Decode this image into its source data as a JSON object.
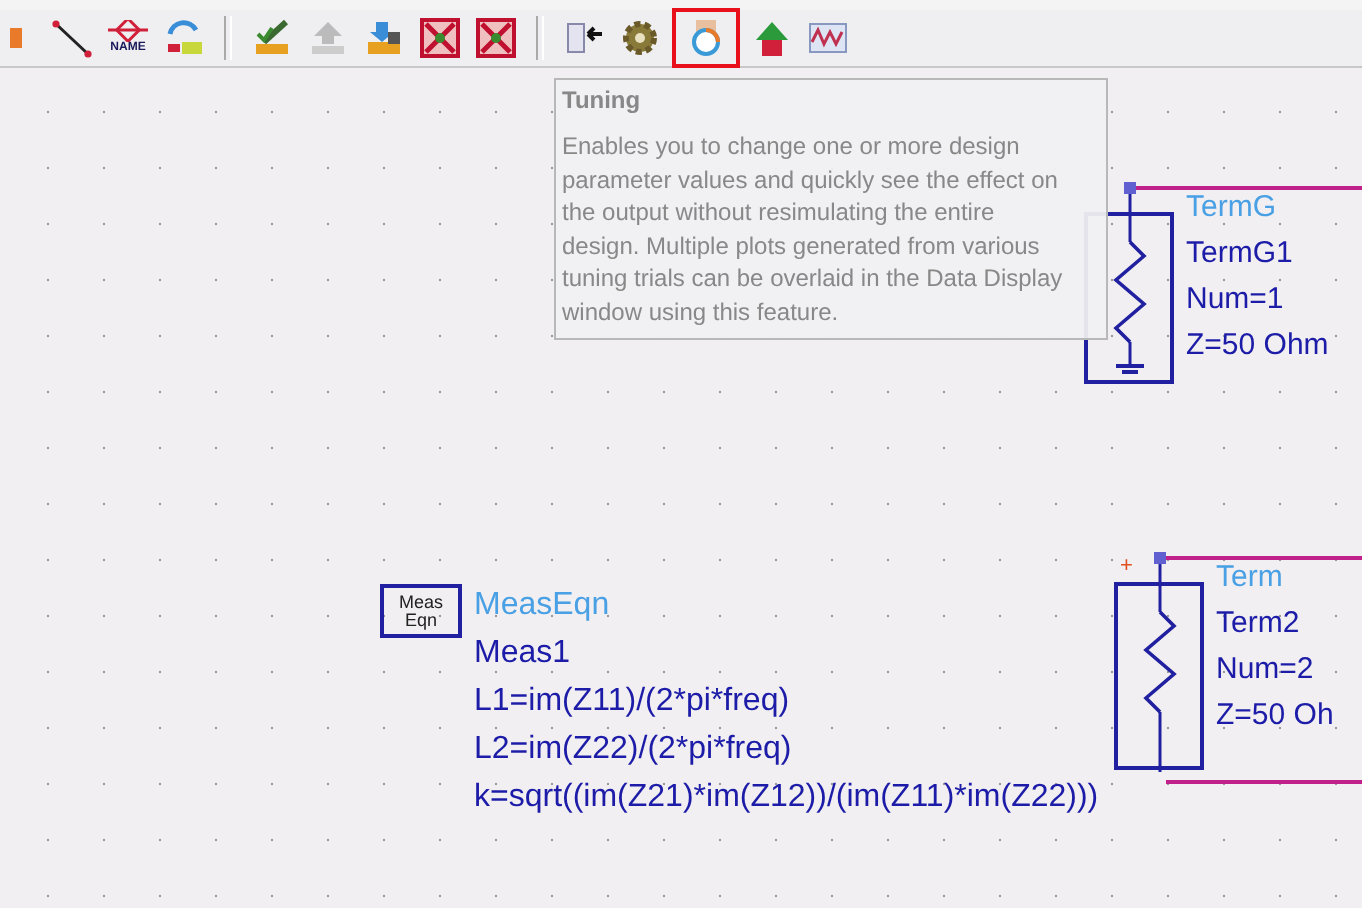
{
  "toolbar": {
    "groups": [
      {
        "items": [
          {
            "kind": "port",
            "highlighted": false
          },
          {
            "kind": "wire",
            "highlighted": false
          },
          {
            "kind": "name",
            "label": "NAME",
            "highlighted": false
          },
          {
            "kind": "swap",
            "highlighted": false
          }
        ]
      },
      {
        "items": [
          {
            "kind": "edit",
            "highlighted": false
          },
          {
            "kind": "up",
            "highlighted": false
          },
          {
            "kind": "down",
            "highlighted": false
          },
          {
            "kind": "cross",
            "highlighted": false
          },
          {
            "kind": "cross",
            "highlighted": false
          }
        ]
      },
      {
        "items": [
          {
            "kind": "push",
            "highlighted": false
          },
          {
            "kind": "gear",
            "highlighted": false
          },
          {
            "kind": "tune",
            "highlighted": true
          },
          {
            "kind": "arrow",
            "highlighted": false
          },
          {
            "kind": "wave",
            "highlighted": false
          }
        ]
      }
    ]
  },
  "tooltip": {
    "title": "Tuning",
    "text": "Enables you to change one or more design parameter values and quickly see the effect on the output without resimulating the entire design. Multiple plots generated from various tuning trials can be overlaid in the Data Display window using this feature."
  },
  "schematic": {
    "terms": [
      {
        "kind": "ground",
        "type": "TermG",
        "name": "TermG1",
        "params": [
          "Num=1",
          "Z=50 Ohm"
        ]
      },
      {
        "kind": "plain",
        "polarity": "+",
        "type": "Term",
        "name": "Term2",
        "params": [
          "Num=2",
          "Z=50 Oh"
        ]
      }
    ],
    "meas_eqn": {
      "icon_label": [
        "Meas",
        "Eqn"
      ],
      "type": "MeasEqn",
      "name": "Meas1",
      "equations": [
        "L1=im(Z11)/(2*pi*freq)",
        "L2=im(Z22)/(2*pi*freq)",
        "k=sqrt((im(Z21)*im(Z12))/(im(Z11)*im(Z22)))"
      ]
    }
  }
}
